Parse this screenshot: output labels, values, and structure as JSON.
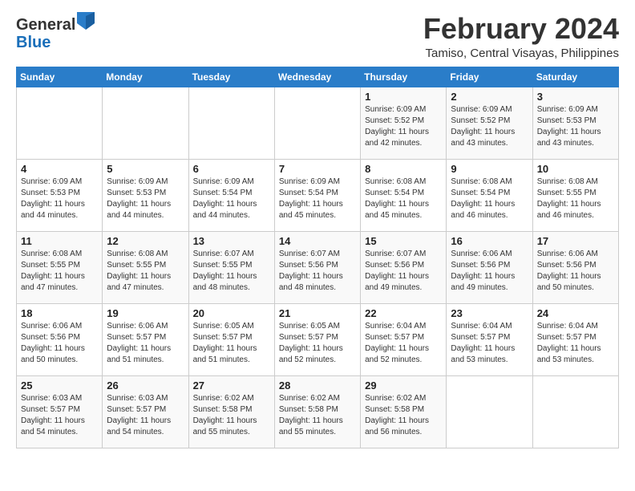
{
  "logo": {
    "general": "General",
    "blue": "Blue"
  },
  "title": "February 2024",
  "subtitle": "Tamiso, Central Visayas, Philippines",
  "days_of_week": [
    "Sunday",
    "Monday",
    "Tuesday",
    "Wednesday",
    "Thursday",
    "Friday",
    "Saturday"
  ],
  "weeks": [
    [
      {
        "day": "",
        "info": ""
      },
      {
        "day": "",
        "info": ""
      },
      {
        "day": "",
        "info": ""
      },
      {
        "day": "",
        "info": ""
      },
      {
        "day": "1",
        "info": "Sunrise: 6:09 AM\nSunset: 5:52 PM\nDaylight: 11 hours and 42 minutes."
      },
      {
        "day": "2",
        "info": "Sunrise: 6:09 AM\nSunset: 5:52 PM\nDaylight: 11 hours and 43 minutes."
      },
      {
        "day": "3",
        "info": "Sunrise: 6:09 AM\nSunset: 5:53 PM\nDaylight: 11 hours and 43 minutes."
      }
    ],
    [
      {
        "day": "4",
        "info": "Sunrise: 6:09 AM\nSunset: 5:53 PM\nDaylight: 11 hours and 44 minutes."
      },
      {
        "day": "5",
        "info": "Sunrise: 6:09 AM\nSunset: 5:53 PM\nDaylight: 11 hours and 44 minutes."
      },
      {
        "day": "6",
        "info": "Sunrise: 6:09 AM\nSunset: 5:54 PM\nDaylight: 11 hours and 44 minutes."
      },
      {
        "day": "7",
        "info": "Sunrise: 6:09 AM\nSunset: 5:54 PM\nDaylight: 11 hours and 45 minutes."
      },
      {
        "day": "8",
        "info": "Sunrise: 6:08 AM\nSunset: 5:54 PM\nDaylight: 11 hours and 45 minutes."
      },
      {
        "day": "9",
        "info": "Sunrise: 6:08 AM\nSunset: 5:54 PM\nDaylight: 11 hours and 46 minutes."
      },
      {
        "day": "10",
        "info": "Sunrise: 6:08 AM\nSunset: 5:55 PM\nDaylight: 11 hours and 46 minutes."
      }
    ],
    [
      {
        "day": "11",
        "info": "Sunrise: 6:08 AM\nSunset: 5:55 PM\nDaylight: 11 hours and 47 minutes."
      },
      {
        "day": "12",
        "info": "Sunrise: 6:08 AM\nSunset: 5:55 PM\nDaylight: 11 hours and 47 minutes."
      },
      {
        "day": "13",
        "info": "Sunrise: 6:07 AM\nSunset: 5:55 PM\nDaylight: 11 hours and 48 minutes."
      },
      {
        "day": "14",
        "info": "Sunrise: 6:07 AM\nSunset: 5:56 PM\nDaylight: 11 hours and 48 minutes."
      },
      {
        "day": "15",
        "info": "Sunrise: 6:07 AM\nSunset: 5:56 PM\nDaylight: 11 hours and 49 minutes."
      },
      {
        "day": "16",
        "info": "Sunrise: 6:06 AM\nSunset: 5:56 PM\nDaylight: 11 hours and 49 minutes."
      },
      {
        "day": "17",
        "info": "Sunrise: 6:06 AM\nSunset: 5:56 PM\nDaylight: 11 hours and 50 minutes."
      }
    ],
    [
      {
        "day": "18",
        "info": "Sunrise: 6:06 AM\nSunset: 5:56 PM\nDaylight: 11 hours and 50 minutes."
      },
      {
        "day": "19",
        "info": "Sunrise: 6:06 AM\nSunset: 5:57 PM\nDaylight: 11 hours and 51 minutes."
      },
      {
        "day": "20",
        "info": "Sunrise: 6:05 AM\nSunset: 5:57 PM\nDaylight: 11 hours and 51 minutes."
      },
      {
        "day": "21",
        "info": "Sunrise: 6:05 AM\nSunset: 5:57 PM\nDaylight: 11 hours and 52 minutes."
      },
      {
        "day": "22",
        "info": "Sunrise: 6:04 AM\nSunset: 5:57 PM\nDaylight: 11 hours and 52 minutes."
      },
      {
        "day": "23",
        "info": "Sunrise: 6:04 AM\nSunset: 5:57 PM\nDaylight: 11 hours and 53 minutes."
      },
      {
        "day": "24",
        "info": "Sunrise: 6:04 AM\nSunset: 5:57 PM\nDaylight: 11 hours and 53 minutes."
      }
    ],
    [
      {
        "day": "25",
        "info": "Sunrise: 6:03 AM\nSunset: 5:57 PM\nDaylight: 11 hours and 54 minutes."
      },
      {
        "day": "26",
        "info": "Sunrise: 6:03 AM\nSunset: 5:57 PM\nDaylight: 11 hours and 54 minutes."
      },
      {
        "day": "27",
        "info": "Sunrise: 6:02 AM\nSunset: 5:58 PM\nDaylight: 11 hours and 55 minutes."
      },
      {
        "day": "28",
        "info": "Sunrise: 6:02 AM\nSunset: 5:58 PM\nDaylight: 11 hours and 55 minutes."
      },
      {
        "day": "29",
        "info": "Sunrise: 6:02 AM\nSunset: 5:58 PM\nDaylight: 11 hours and 56 minutes."
      },
      {
        "day": "",
        "info": ""
      },
      {
        "day": "",
        "info": ""
      }
    ]
  ]
}
